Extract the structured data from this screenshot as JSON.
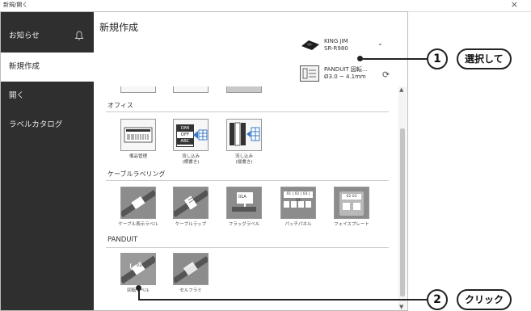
{
  "window": {
    "title": "新規/開く",
    "close": "×"
  },
  "sidebar": {
    "items": [
      {
        "label": "お知らせ"
      },
      {
        "label": "新規作成"
      },
      {
        "label": "開く"
      },
      {
        "label": "ラベルカタログ"
      }
    ]
  },
  "header": {
    "title": "新規作成",
    "printer": {
      "line1": "KING JIM",
      "line2": "SR-R980"
    },
    "chevron": "⌄",
    "tape": {
      "line1": "PANDUIT 図転...",
      "line2": "Ø3.0 ~ 4.1mm"
    },
    "refresh": "⟳"
  },
  "sections": {
    "office": {
      "label": "オフィス",
      "cards": [
        {
          "caption": "備品管理"
        },
        {
          "caption": "流し込み\n(横書き)"
        },
        {
          "caption": "流し込み\n(縦書き)"
        }
      ]
    },
    "cable": {
      "label": "ケーブルラベリング",
      "cards": [
        {
          "caption": "ケーブル表示ラベル"
        },
        {
          "caption": "ケーブルラップ"
        },
        {
          "caption": "フラッグラベル"
        },
        {
          "caption": "パッチパネル"
        },
        {
          "caption": "フェイスプレート"
        }
      ]
    },
    "panduit": {
      "label": "PANDUIT",
      "cards": [
        {
          "caption": "回転ラベル"
        },
        {
          "caption": "セルフラミ"
        }
      ]
    }
  },
  "card_texts": {
    "om": "OMI",
    "off": "OFF",
    "abc": "ABC",
    "flag": "01A",
    "patch": "01 | 02 | 03 | 04",
    "face": "02 03",
    "rot": "01A"
  },
  "callouts": [
    {
      "number": "1",
      "label": "選択して"
    },
    {
      "number": "2",
      "label": "クリック"
    }
  ],
  "colors": {
    "sidebar": "#2f2f2f",
    "active_item": "#ffffff",
    "card_gray": "#8c8c8c"
  }
}
